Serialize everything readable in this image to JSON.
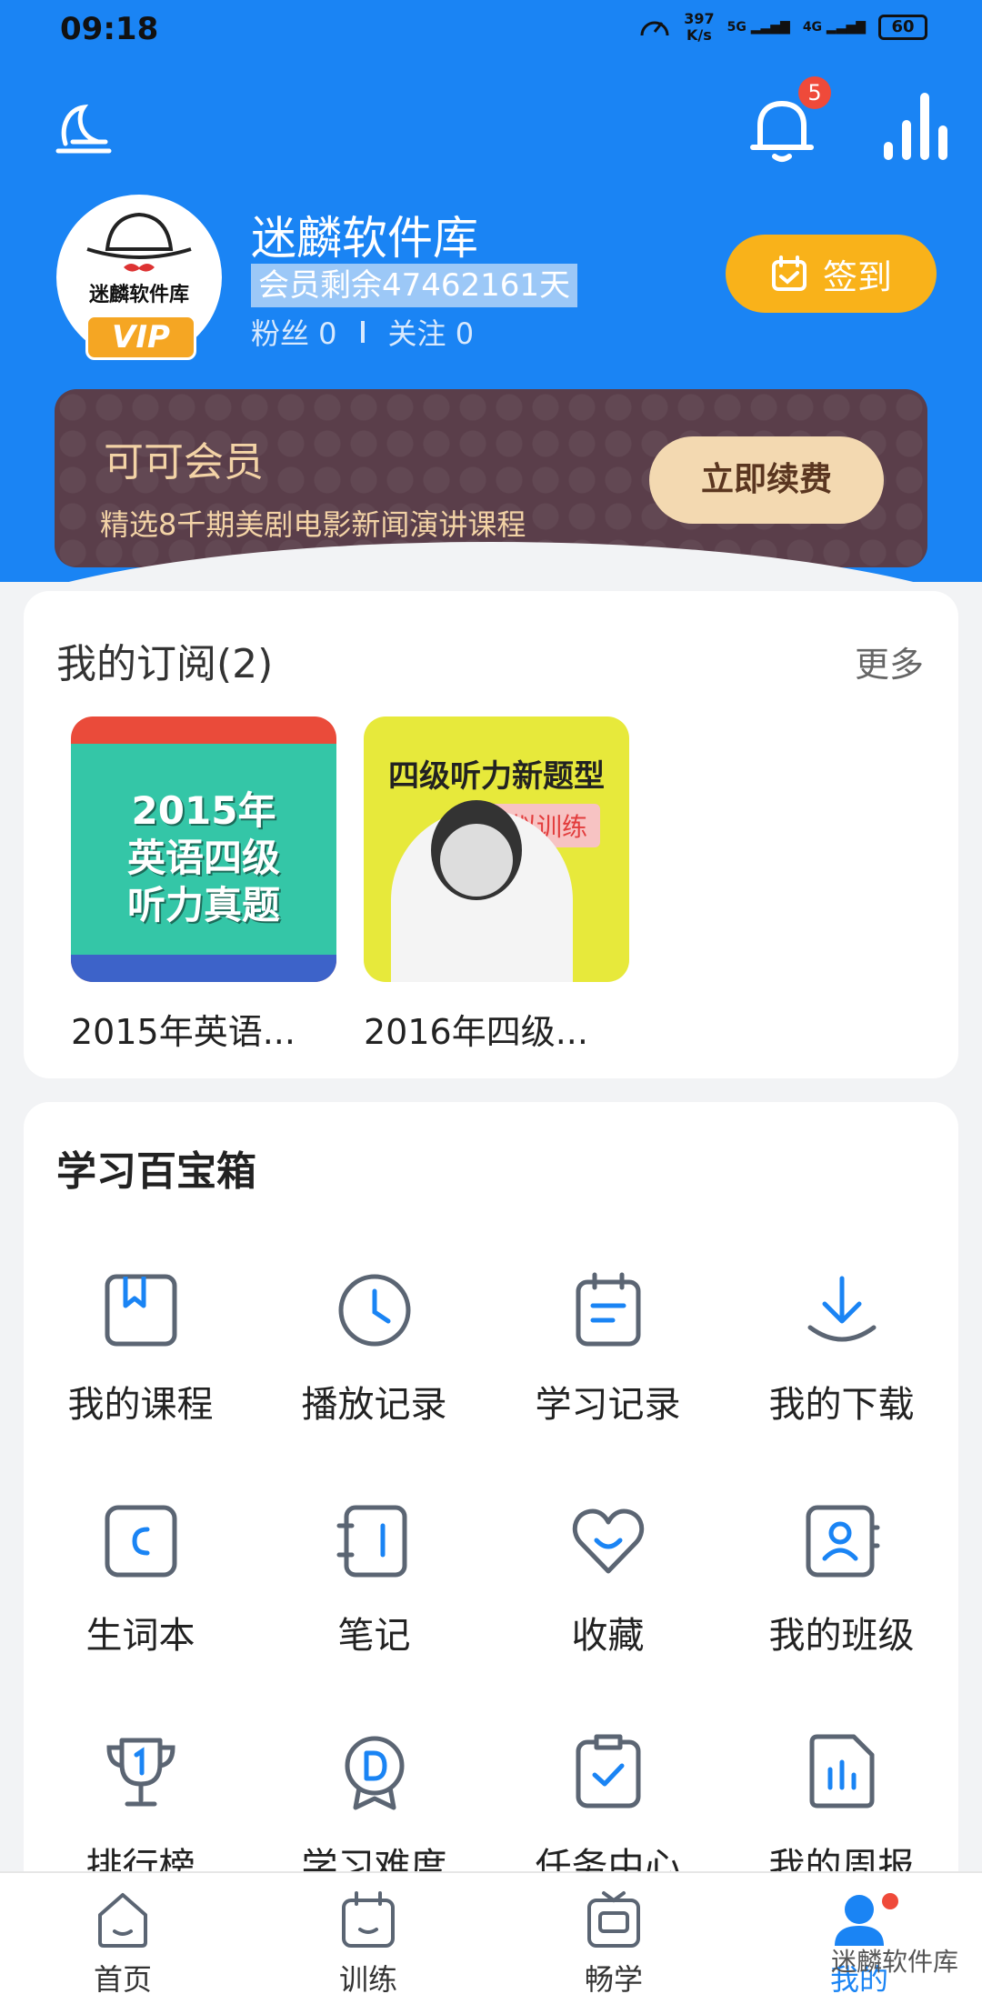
{
  "status": {
    "time": "09:18",
    "speed_value": "397",
    "speed_unit": "K/s",
    "net1": "5G",
    "net2": "4G",
    "battery": "60"
  },
  "header": {
    "notification_count": "5"
  },
  "profile": {
    "avatar_text": "迷麟软件库",
    "vip_label": "VIP",
    "username": "迷麟软件库",
    "member_remaining": "会员剩余47462161天",
    "fans": "粉丝 0",
    "following": "关注 0",
    "signin_label": "签到"
  },
  "vip_banner": {
    "title": "可可会员",
    "desc": "精选8千期美剧电影新闻演讲课程",
    "button": "立即续费"
  },
  "subscriptions": {
    "title": "我的订阅(2)",
    "more": "更多",
    "items": [
      {
        "name": "2015年英语...",
        "cover_text_1": "2015年",
        "cover_text_2": "英语四级",
        "cover_text_3": "听力真题"
      },
      {
        "name": "2016年四级...",
        "cover_title": "四级听力新题型",
        "cover_tag": "模拟训练"
      }
    ]
  },
  "toolbox": {
    "title": "学习百宝箱",
    "items": [
      {
        "label": "我的课程",
        "icon": "bookmark-book-icon"
      },
      {
        "label": "播放记录",
        "icon": "clock-icon"
      },
      {
        "label": "学习记录",
        "icon": "calendar-note-icon"
      },
      {
        "label": "我的下载",
        "icon": "download-icon"
      },
      {
        "label": "生词本",
        "icon": "vocab-book-icon"
      },
      {
        "label": "笔记",
        "icon": "notebook-icon"
      },
      {
        "label": "收藏",
        "icon": "heart-icon"
      },
      {
        "label": "我的班级",
        "icon": "class-contact-icon"
      },
      {
        "label": "排行榜",
        "icon": "trophy-icon"
      },
      {
        "label": "学习难度",
        "icon": "difficulty-medal-icon"
      },
      {
        "label": "任务中心",
        "icon": "task-clipboard-icon"
      },
      {
        "label": "我的周报",
        "icon": "weekly-report-icon"
      }
    ]
  },
  "nav": {
    "items": [
      {
        "label": "首页",
        "icon": "home-icon"
      },
      {
        "label": "训练",
        "icon": "train-icon"
      },
      {
        "label": "畅学",
        "icon": "tv-icon"
      },
      {
        "label": "我的",
        "icon": "profile-icon"
      }
    ]
  },
  "watermark": "迷麟软件库",
  "colors": {
    "brand_blue": "#1a84f4",
    "sign_orange": "#f9b21a",
    "vip_card_bg": "#5a3e4a",
    "vip_gold": "#f3d3a6",
    "badge_red": "#ef4a3a"
  }
}
